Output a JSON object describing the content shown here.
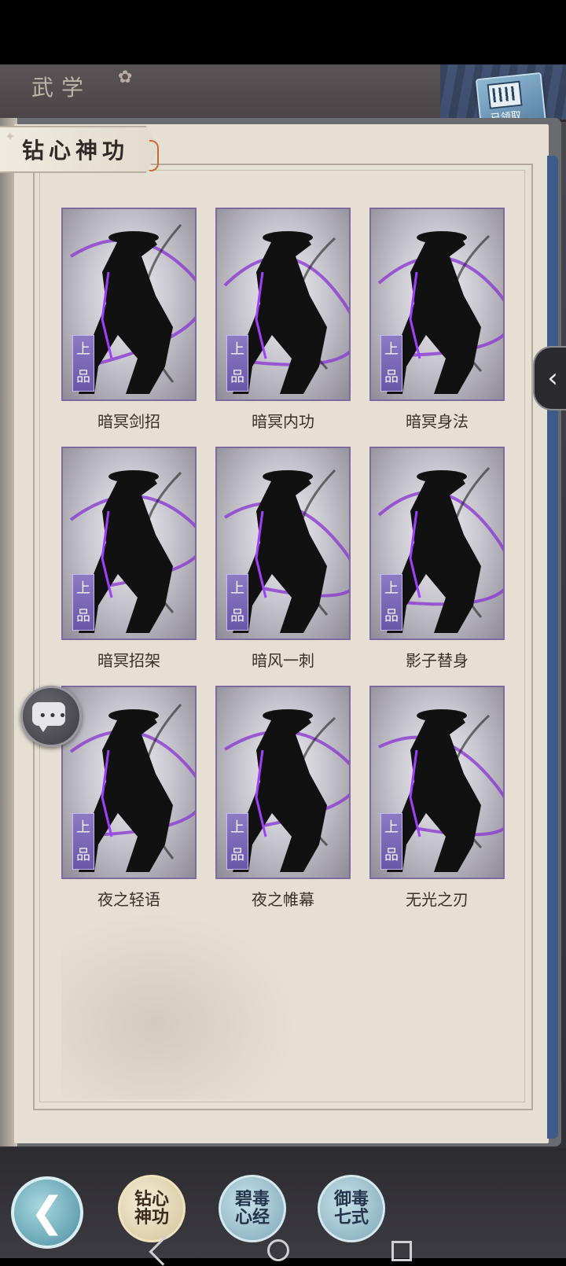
{
  "screen": {
    "title": "武学",
    "claimed_badge": "已领取",
    "section_title": "钻心神功"
  },
  "skills": [
    {
      "name": "暗冥剑招",
      "grade": [
        "上",
        "品"
      ]
    },
    {
      "name": "暗冥内功",
      "grade": [
        "上",
        "品"
      ]
    },
    {
      "name": "暗冥身法",
      "grade": [
        "上",
        "品"
      ]
    },
    {
      "name": "暗冥招架",
      "grade": [
        "上",
        "品"
      ]
    },
    {
      "name": "暗风一刺",
      "grade": [
        "上",
        "品"
      ]
    },
    {
      "name": "影子替身",
      "grade": [
        "上",
        "品"
      ]
    },
    {
      "name": "夜之轻语",
      "grade": [
        "上",
        "品"
      ]
    },
    {
      "name": "夜之帷幕",
      "grade": [
        "上",
        "品"
      ]
    },
    {
      "name": "无光之刃",
      "grade": [
        "上",
        "品"
      ]
    }
  ],
  "bottom_tabs": [
    {
      "label": "钻心神功",
      "active": true
    },
    {
      "label": "碧毒心经",
      "active": false
    },
    {
      "label": "御毒七式",
      "active": false
    }
  ],
  "icons": {
    "back": "back-arrow-icon",
    "side_tab": "chevron-left-icon",
    "chat": "chat-bubble-icon"
  },
  "colors": {
    "card_border": "#7e6a9e",
    "grade_badge": "#7a68b8",
    "page": "#e6e0d4"
  }
}
